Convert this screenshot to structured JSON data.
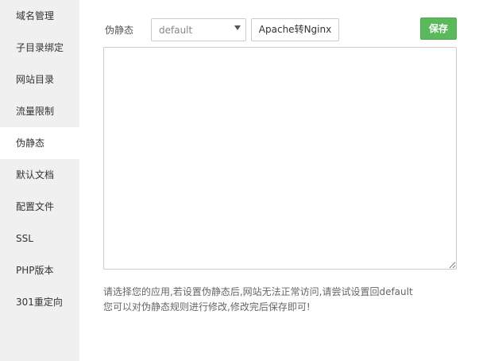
{
  "sidebar": {
    "items": [
      {
        "label": "域名管理"
      },
      {
        "label": "子目录绑定"
      },
      {
        "label": "网站目录"
      },
      {
        "label": "流量限制"
      },
      {
        "label": "伪静态",
        "active": true
      },
      {
        "label": "默认文档"
      },
      {
        "label": "配置文件"
      },
      {
        "label": "SSL"
      },
      {
        "label": "PHP版本"
      },
      {
        "label": "301重定向"
      }
    ]
  },
  "rewrite": {
    "label": "伪静态",
    "select_value": "default",
    "convert_label": "Apache转Nginx",
    "save_label": "保存",
    "editor_value": "",
    "tips": [
      "请选择您的应用,若设置伪静态后,网站无法正常访问,请尝试设置回default",
      "您可以对伪静态规则进行修改,修改完后保存即可!"
    ]
  },
  "colors": {
    "sidebar_bg": "#f0f0f0",
    "save_button": "#5cb85c"
  }
}
